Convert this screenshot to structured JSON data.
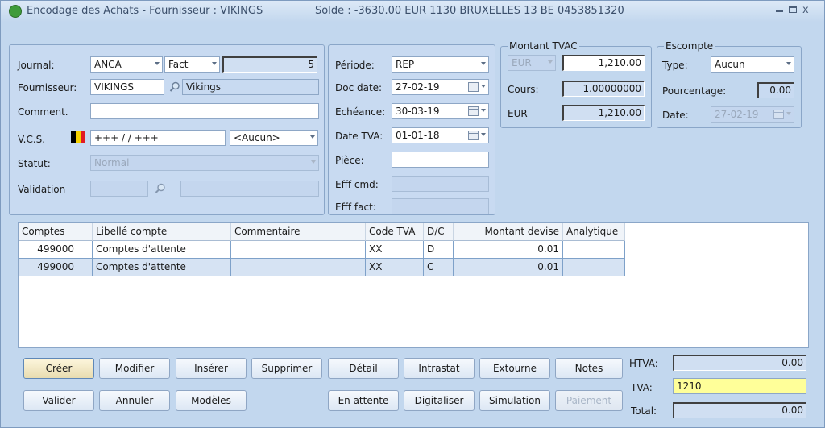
{
  "window": {
    "title": "Encodage des Achats - Fournisseur : VIKINGS",
    "solde": "Solde : -3630.00 EUR 1130 BRUXELLES 13 BE 0453851320"
  },
  "header": {
    "journal_label": "Journal:",
    "journal_value": "ANCA",
    "journal_type": "Fact",
    "journal_number": "5",
    "fournisseur_label": "Fournisseur:",
    "fournisseur_value": "VIKINGS",
    "fournisseur_name": "Vikings",
    "comment_label": "Comment.",
    "comment_value": "",
    "vcs_label": "V.C.S.",
    "vcs_value": "+++ / / +++",
    "vcs_option": "<Aucun>",
    "statut_label": "Statut:",
    "statut_value": "Normal",
    "validation_label": "Validation"
  },
  "dates": {
    "periode_label": "Période:",
    "periode_value": "REP",
    "docdate_label": "Doc date:",
    "docdate_value": "27-02-19",
    "echeance_label": "Echéance:",
    "echeance_value": "30-03-19",
    "datetva_label": "Date TVA:",
    "datetva_value": "01-01-18",
    "piece_label": "Pièce:",
    "piece_value": "",
    "effcmd_label": "Efff cmd:",
    "efffact_label": "Efff fact:"
  },
  "montant": {
    "title": "Montant TVAC",
    "currency": "EUR",
    "amount": "1,210.00",
    "cours_label": "Cours:",
    "cours_value": "1.00000000",
    "eur_label": "EUR",
    "eur_value": "1,210.00"
  },
  "escompte": {
    "title": "Escompte",
    "type_label": "Type:",
    "type_value": "Aucun",
    "pct_label": "Pourcentage:",
    "pct_value": "0.00",
    "date_label": "Date:",
    "date_value": "27-02-19"
  },
  "grid": {
    "columns": [
      "Comptes",
      "Libellé compte",
      "Commentaire",
      "Code TVA",
      "D/C",
      "Montant devise",
      "Analytique"
    ],
    "rows": [
      {
        "compte": "499000",
        "libelle": "Comptes d'attente",
        "commentaire": "",
        "code_tva": "XX",
        "dc": "D",
        "montant": "0.01",
        "analytique": ""
      },
      {
        "compte": "499000",
        "libelle": "Comptes d'attente",
        "commentaire": "",
        "code_tva": "XX",
        "dc": "C",
        "montant": "0.01",
        "analytique": ""
      }
    ]
  },
  "buttons": {
    "creer": "Créer",
    "modifier": "Modifier",
    "inserer": "Insérer",
    "supprimer": "Supprimer",
    "detail": "Détail",
    "intrastat": "Intrastat",
    "extourne": "Extourne",
    "notes": "Notes",
    "valider": "Valider",
    "annuler": "Annuler",
    "modeles": "Modèles",
    "en_attente": "En attente",
    "digitaliser": "Digitaliser",
    "simulation": "Simulation",
    "paiement": "Paiement"
  },
  "totals": {
    "htva_label": "HTVA:",
    "htva_value": "0.00",
    "tva_label": "TVA:",
    "tva_value": "1210",
    "total_label": "Total:",
    "total_value": "0.00"
  },
  "colors": {
    "accent": "#c2d7ee",
    "highlight": "#ffff99",
    "flag_black": "#000000",
    "flag_yellow": "#f5d000",
    "flag_red": "#e21b23"
  }
}
